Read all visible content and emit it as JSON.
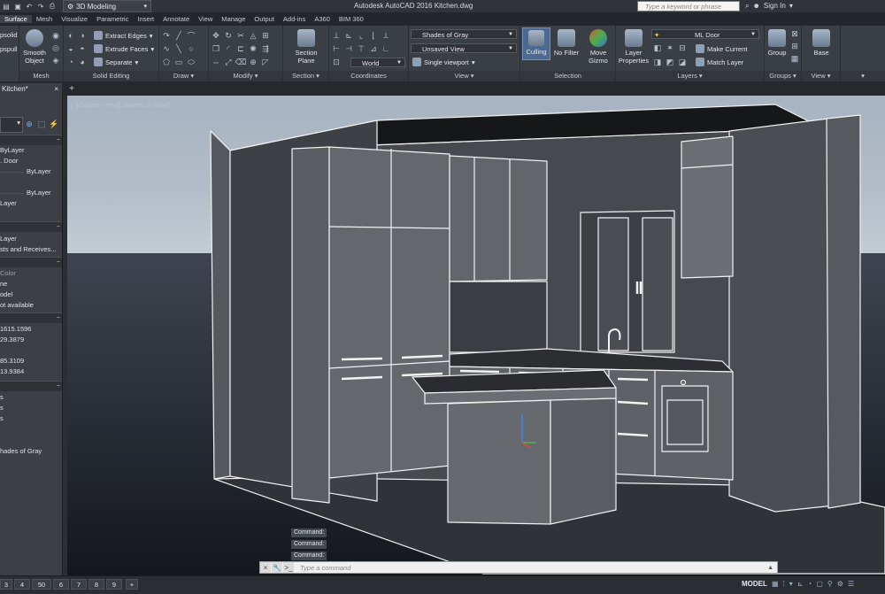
{
  "titlebar": {
    "workspace": "3D Modeling",
    "app_title": "Autodesk AutoCAD 2016   Kitchen.dwg",
    "search_placeholder": "Type a keyword or phrase",
    "sign_in": "Sign In"
  },
  "menu": [
    "Surface",
    "Mesh",
    "Visualize",
    "Parametric",
    "Insert",
    "Annotate",
    "View",
    "Manage",
    "Output",
    "Add-ins",
    "A360",
    "BIM 360"
  ],
  "ribbon": {
    "left_items": [
      "psolid",
      "pspull"
    ],
    "mesh": {
      "title": "Mesh",
      "smooth_object": "Smooth Object"
    },
    "solid_editing": {
      "title": "Solid Editing",
      "tools": [
        "Extract Edges",
        "Extrude Faces",
        "Separate"
      ]
    },
    "draw": {
      "title": "Draw"
    },
    "modify": {
      "title": "Modify"
    },
    "section": {
      "title": "Section",
      "section_plane": "Section Plane"
    },
    "coordinates": {
      "title": "Coordinates",
      "ucs": "World"
    },
    "view": {
      "title": "View",
      "visual_style": "Shades of Gray",
      "named_view": "Unsaved View",
      "viewport": "Single viewport"
    },
    "selection": {
      "title": "Selection",
      "culling": "Culling",
      "no_filter": "No Filter",
      "move_gizmo": "Move Gizmo"
    },
    "layers": {
      "title": "Layers",
      "layer_properties": "Layer Properties",
      "current_layer": "ML Door",
      "make_current": "Make Current",
      "match_layer": "Match Layer"
    },
    "groups": {
      "title": "Groups",
      "group": "Group"
    },
    "view2": {
      "title": "View",
      "base": "Base"
    }
  },
  "file_tab": "Kitchen*",
  "properties": {
    "rows": [
      "ByLayer",
      ". Door",
      "ByLayer",
      "ByLayer",
      "Layer",
      "Layer",
      "sts  and  Receives...",
      "Color",
      "ne",
      "odel",
      "ot available",
      "1615.1596",
      "29.3879",
      "85.3109",
      "13.9384",
      "s",
      "s",
      "s",
      "hades of Gray"
    ]
  },
  "viewport_label": "[-][Custom View][Shades of Gray]",
  "command_history": [
    "Command:",
    "Command:",
    "Command:"
  ],
  "command_placeholder": "Type  a  command",
  "layout_tabs": [
    "3",
    "4",
    "50",
    "6",
    "7",
    "8",
    "9"
  ],
  "status": {
    "model": "MODEL"
  },
  "colors": {
    "ribbon_bg": "#3a3e45",
    "viewport_sky": "#a9b6c5",
    "viewport_ground": "#1f232a",
    "wall": "#4a4d52",
    "cabinet": "#5a5d62",
    "edge": "#f2f2f2"
  }
}
